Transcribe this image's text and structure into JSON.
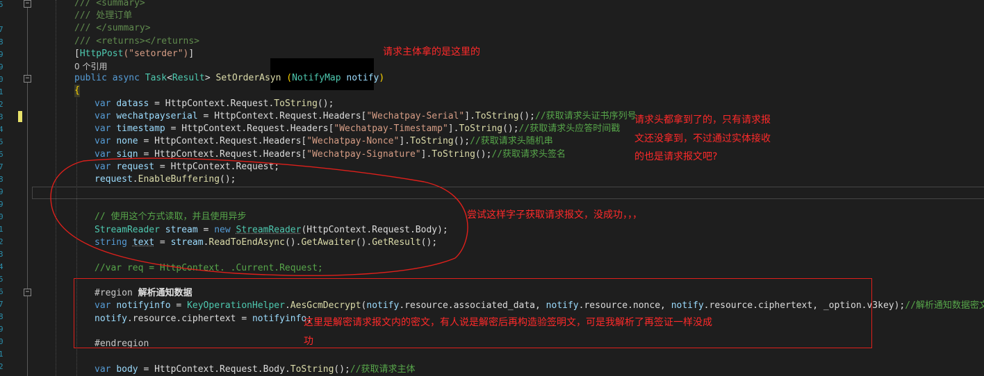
{
  "line_numbers": [
    "5",
    "7",
    "8",
    "9",
    "9",
    "0",
    "1",
    "2",
    "3",
    "4",
    "5",
    "6",
    "7",
    "8",
    "9",
    "9",
    "0",
    "1",
    "2",
    "3",
    "4",
    "5",
    "6",
    "7",
    "8",
    "9",
    "0",
    "1",
    "2",
    "3"
  ],
  "code": {
    "summary_open": "/// <summary>",
    "summary_text": "/// 处理订单",
    "summary_close": "/// </summary>",
    "returns": "/// <returns></returns>",
    "attr_open": "[",
    "attr_name": "HttpPost",
    "attr_arg": "(\"setorder\")",
    "attr_close": "]",
    "refs": "0 个引用",
    "sig_public": "public",
    "sig_async": "async",
    "sig_task": "Task",
    "sig_lt": "<",
    "sig_result": "Result",
    "sig_gt": ">",
    "sig_method": "SetOrderAsyn",
    "sig_param_open": "(",
    "sig_param_type": "NotifyMap",
    "sig_param_name": "notify",
    "sig_param_close": ")",
    "brace_open": "{",
    "l1": {
      "kw": "var",
      "name": "datass",
      "rest": " = HttpContext.Request.",
      "m": "ToString",
      "end": "();"
    },
    "l2": {
      "kw": "var",
      "name": "wechatpayserial",
      "pre": " = HttpContext.Request.Headers[",
      "s": "\"Wechatpay-Serial\"",
      "mid": "].",
      "m": "ToString",
      "end": "();",
      "c": "//获取请求头证书序列号"
    },
    "l3": {
      "kw": "var",
      "name": "timestamp",
      "pre": " = HttpContext.Request.Headers[",
      "s": "\"Wechatpay-Timestamp\"",
      "mid": "].",
      "m": "ToString",
      "end": "();",
      "c": "//获取请求头应答时间戳"
    },
    "l4": {
      "kw": "var",
      "name": "none",
      "pre": " = HttpContext.Request.Headers[",
      "s": "\"Wechatpay-Nonce\"",
      "mid": "].",
      "m": "ToString",
      "end": "();",
      "c": "//获取请求头随机串"
    },
    "l5": {
      "kw": "var",
      "name": "sign",
      "pre": " = HttpContext.Request.Headers[",
      "s": "\"Wechatpay-Signature\"",
      "mid": "].",
      "m": "ToString",
      "end": "();",
      "c": "//获取请求头签名"
    },
    "l6": {
      "kw": "var",
      "name": "request",
      "rest": " = HttpContext.Request;"
    },
    "l7": {
      "name": "request",
      "dot": ".",
      "m": "EnableBuffering",
      "end": "();"
    },
    "l8_comment": "// 使用这个方式读取，并且使用异步",
    "l9": {
      "t": "StreamReader",
      "name": "stream",
      "eq": " = ",
      "kw": "new",
      "t2": "StreamReader",
      "rest": "(HttpContext.Request.Body);"
    },
    "l10": {
      "kw": "string",
      "name": "text",
      "eq": " = ",
      "v": "stream",
      "dot": ".",
      "m": "ReadToEndAsync",
      "mid": "().",
      "m2": "GetAwaiter",
      "mid2": "().",
      "m3": "GetResult",
      "end": "();"
    },
    "l11_comment": "//var req = HttpContext. .Current.Request;",
    "region_kw": "#region",
    "region_name": "解析通知数据",
    "l12": {
      "kw": "var",
      "name": "notifyinfo",
      "eq": " = ",
      "t": "KeyOperationHelper",
      "dot": ".",
      "m": "AesGcmDecrypt",
      "p1": "(",
      "a1": "notify",
      "a1r": ".resource.associated_data, ",
      "a2": "notify",
      "a2r": ".resource.nonce, ",
      "a3": "notify",
      "a3r": ".resource.ciphertext, _option.v3key);",
      "c": "//解析通知数据密文"
    },
    "l13": {
      "v": "notify",
      "rest": ".resource.ciphertext = ",
      "v2": "notifyinfo",
      "end": ";"
    },
    "endregion": "#endregion",
    "l14": {
      "kw": "var",
      "name": "body",
      "rest": " = HttpContext.Request.Body.",
      "m": "ToString",
      "end": "();",
      "c": "//获取请求主体"
    }
  },
  "annotations": {
    "a1": "请求主体拿的是这里的",
    "a2_1": "请求头都拿到了的，只有请求报",
    "a2_2": "文还没拿到，不过通过实体接收",
    "a2_3": "的也是请求报文吧?",
    "a3": "尝试这样字子获取请求报文，没成功，，，",
    "a4_1": "这里是解密请求报文内的密文，有人说是解密后再构造验签明文，可是我解析了再签证一样没成",
    "a4_2": "功"
  },
  "colors": {
    "annotation": "#ff2a2a",
    "background": "#1e1e1e",
    "keyword": "#569cd6",
    "type": "#4ec9b0",
    "comment": "#57a64a",
    "string": "#d69d85"
  }
}
